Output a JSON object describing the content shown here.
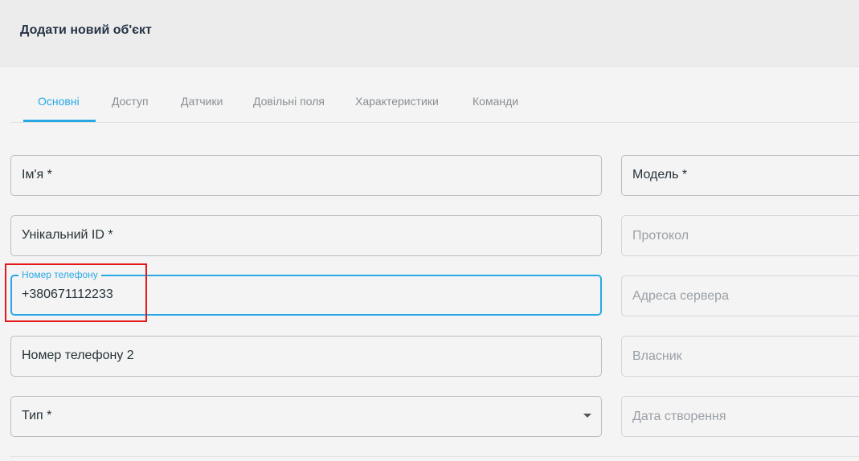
{
  "header": {
    "title": "Додати новий об'єкт"
  },
  "tabs": [
    {
      "label": "Основні",
      "active": true
    },
    {
      "label": "Доступ"
    },
    {
      "label": "Датчики"
    },
    {
      "label": "Довільні поля"
    },
    {
      "label": "Характеристики"
    },
    {
      "label": "Команди"
    }
  ],
  "form": {
    "left": {
      "name": {
        "value": "Ім'я *"
      },
      "unique_id": {
        "value": "Унікальний ID *"
      },
      "phone": {
        "label": "Номер телефону",
        "value": "+380671112233"
      },
      "phone2": {
        "value": "Номер телефону 2"
      },
      "type": {
        "value": "Тип *",
        "icon": "chevron-down-icon"
      }
    },
    "right": {
      "model": {
        "value": "Модель *"
      },
      "protocol": {
        "placeholder": "Протокол"
      },
      "server_address": {
        "placeholder": "Адреса сервера"
      },
      "owner": {
        "placeholder": "Власник"
      },
      "created_date": {
        "placeholder": "Дата створення"
      }
    }
  },
  "colors": {
    "accent": "#29a8e6",
    "highlight": "#e51919",
    "background": "#f4f4f4",
    "header_bg": "#ececec"
  }
}
